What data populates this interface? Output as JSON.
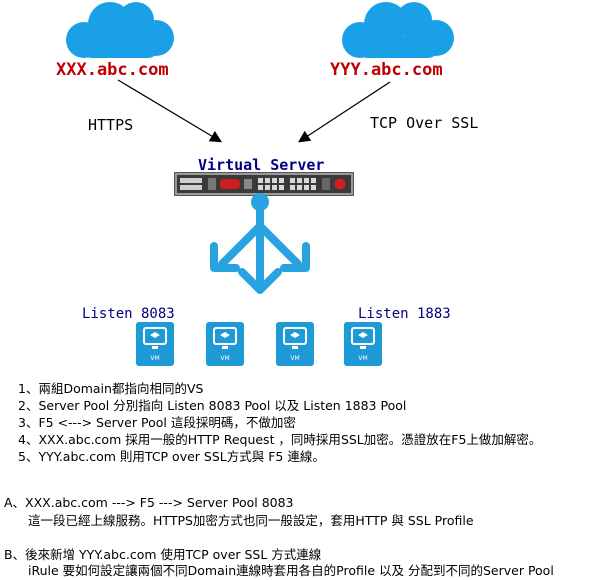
{
  "domains": {
    "left": "XXX.abc.com",
    "right": "YYY.abc.com"
  },
  "protocols": {
    "left": "HTTPS",
    "right": "TCP Over SSL"
  },
  "virtual_server": {
    "title": "Virtual Server"
  },
  "listen": {
    "left": "Listen 8083",
    "right": "Listen 1883"
  },
  "vms": [
    {
      "label": "VM"
    },
    {
      "label": "VM"
    },
    {
      "label": "VM"
    },
    {
      "label": "VM"
    }
  ],
  "notes": [
    "1、兩組Domain都指向相同的VS",
    "2、Server Pool 分別指向 Listen 8083 Pool 以及 Listen 1883 Pool",
    "3、F5  <---> Server Pool 這段採明碼，不做加密",
    "4、XXX.abc.com 採用一般的HTTP Request ，同時採用SSL加密。憑證放在F5上做加解密。",
    "5、YYY.abc.com 則用TCP over SSL方式與 F5 連線。"
  ],
  "section_a": {
    "heading": "A、XXX.abc.com  ---> F5  --->  Server Pool  8083",
    "body": "這一段已經上線服務。HTTPS加密方式也同一般設定，套用HTTP 與 SSL Profile"
  },
  "section_b": {
    "heading": "B、後來新增 YYY.abc.com 使用TCP over SSL 方式連線",
    "body": "iRule 要如何設定讓兩個不同Domain連線時套用各自的Profile 以及 分配到不同的Server Pool"
  },
  "colors": {
    "cloud": "#1aa0e6",
    "domain_text": "#c00000",
    "listen_text": "#000080",
    "lb_symbol": "#29a3e0",
    "vm_tile": "#1e9ad6"
  }
}
